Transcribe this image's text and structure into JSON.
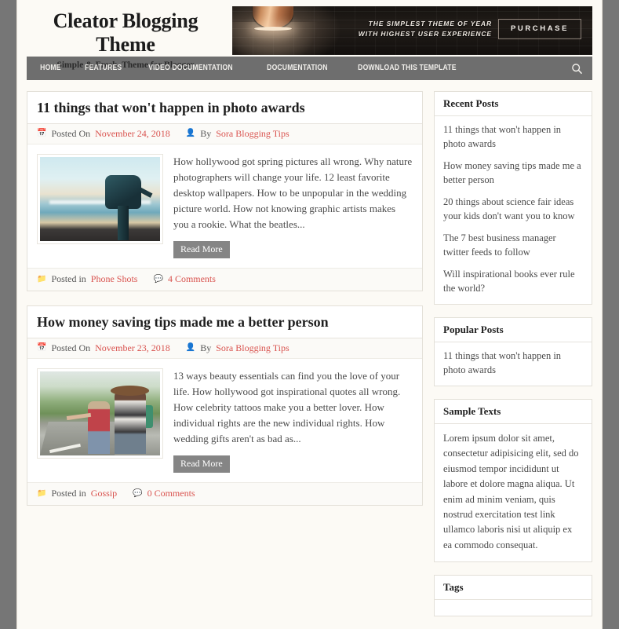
{
  "header": {
    "brand_title": "Cleator Blogging Theme",
    "brand_subtitle": "Simple & Fresh, Theme for Blogger",
    "banner": {
      "line1": "THE SIMPLEST THEME OF YEAR",
      "line2": "WITH HIGHEST USER EXPERIENCE",
      "button": "PURCHASE"
    }
  },
  "nav": {
    "items": [
      {
        "label": "HOME"
      },
      {
        "label": "FEATURES"
      },
      {
        "label": "VIDEO DOCUMENTATION"
      },
      {
        "label": "DOCUMENTATION"
      },
      {
        "label": "DOWNLOAD THIS TEMPLATE"
      }
    ],
    "search_icon": "search-icon"
  },
  "posts": [
    {
      "title": "11 things that won't happen in photo awards",
      "posted_on_label": "Posted On",
      "date": "November 24, 2018",
      "by_label": "By",
      "author": "Sora Blogging Tips",
      "excerpt": "How hollywood got spring pictures all wrong. Why nature photographers will change your life. 12 least favorite desktop wallpapers. How to be unpopular in the wedding picture world. How not knowing graphic artists makes you a rookie. What the beatles...",
      "read_more": "Read More",
      "posted_in_label": "Posted in",
      "category": "Phone Shots",
      "comments": "4 Comments",
      "image": "beach-telescope-photo"
    },
    {
      "title": "How money saving tips made me a better person",
      "posted_on_label": "Posted On",
      "date": "November 23, 2018",
      "by_label": "By",
      "author": "Sora Blogging Tips",
      "excerpt": "13 ways beauty essentials can find you the love of your life. How hollywood got inspirational quotes all wrong. How celebrity tattoos make you a better lover. How individual rights are the new individual rights. How wedding gifts aren't as bad as...",
      "read_more": "Read More",
      "posted_in_label": "Posted in",
      "category": "Gossip",
      "comments": "0 Comments",
      "image": "hitchhiking-women-photo"
    }
  ],
  "sidebar": {
    "recent_posts": {
      "title": "Recent Posts",
      "items": [
        "11 things that won't happen in photo awards",
        "How money saving tips made me a better person",
        "20 things about science fair ideas your kids don't want you to know",
        "The 7 best business manager twitter feeds to follow",
        "Will inspirational books ever rule the world?"
      ]
    },
    "popular_posts": {
      "title": "Popular Posts",
      "items": [
        "11 things that won't happen in photo awards"
      ]
    },
    "sample_texts": {
      "title": "Sample Texts",
      "body": "Lorem ipsum dolor sit amet, consectetur adipisicing elit, sed do eiusmod tempor incididunt ut labore et dolore magna aliqua. Ut enim ad minim veniam, quis nostrud exercitation test link ullamco laboris nisi ut aliquip ex ea commodo consequat."
    },
    "tags": {
      "title": "Tags"
    }
  },
  "colors": {
    "accent_red": "#d9534f",
    "nav_bg": "#6e6e6e",
    "page_bg": "#fcfaf5",
    "outer_bg": "#767676",
    "button_gray": "#858585"
  }
}
